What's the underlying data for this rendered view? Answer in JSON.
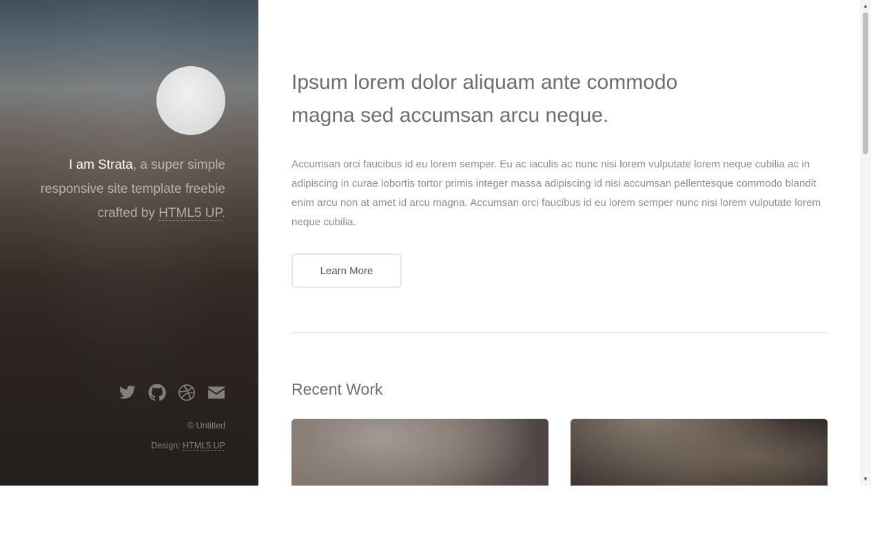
{
  "sidebar": {
    "intro_strong": "I am Strata",
    "intro_text": ", a super simple responsive site template freebie crafted by ",
    "intro_link": "HTML5 UP",
    "intro_end": ".",
    "social_icons": [
      "twitter-icon",
      "github-icon",
      "dribbble-icon",
      "envelope-icon"
    ],
    "copyright": "© Untitled",
    "design_label": "Design: ",
    "design_link": "HTML5 UP"
  },
  "main": {
    "headline": "Ipsum lorem dolor aliquam ante commodo magna sed accumsan arcu neque.",
    "body": "Accumsan orci faucibus id eu lorem semper. Eu ac iaculis ac nunc nisi lorem vulputate lorem neque cubilia ac in adipiscing in curae lobortis tortor primis integer massa adipiscing id nisi accumsan pellentesque commodo blandit enim arcu non at amet id arcu magna. Accumsan orci faucibus id eu lorem semper nunc nisi lorem vulputate lorem neque cubilia.",
    "button_label": "Learn More",
    "section_title": "Recent Work"
  },
  "scrollbar": {
    "up_arrow": "▲",
    "down_arrow": "▼"
  },
  "colors": {
    "sidebar_top": "#3f505b",
    "sidebar_bottom": "#251f1c",
    "heading_text": "#6e6e6e",
    "body_text": "#8e8e8e"
  }
}
